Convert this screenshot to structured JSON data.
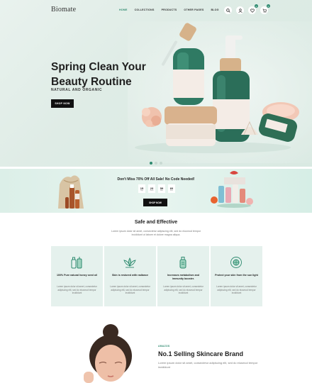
{
  "header": {
    "logo": "Biomate",
    "nav": [
      "HOME",
      "COLLECTIONS",
      "PRODUCTS",
      "OTHER PAGES",
      "BLOG"
    ],
    "icons": [
      "search-icon",
      "user-icon",
      "heart-icon",
      "cart-icon"
    ],
    "wishlist_count": "0",
    "cart_count": "0"
  },
  "hero": {
    "title": "Spring Clean Your Beauty Routine",
    "subtitle": "NATURAL AND ORGANIC",
    "button": "SHOP NOW",
    "product_labels": [
      "SQUALANE OIL",
      "SQUALANE + OMEGA REPAIR CREAM",
      "BIOSSANCE"
    ]
  },
  "promo": {
    "text": "Don't Miss 70% Off All Sale! No Code Needed!",
    "countdown": [
      {
        "value": "15",
        "label": "Days"
      },
      {
        "value": "23",
        "label": "Hours"
      },
      {
        "value": "59",
        "label": "Mins"
      },
      {
        "value": "60",
        "label": "Secs"
      }
    ],
    "button": "SHOP NOW"
  },
  "safe": {
    "title": "Safe and Effective",
    "text": "Lorem ipsum dolor sit amet, consectetur adipiscing elit, sed do eiusmod tempor incididunt ut labore et dolore magna aliqua.",
    "features": [
      {
        "icon": "bottle-icon",
        "title": "100% Pure natural honey seed oil",
        "text": "Lorem ipsum dolor sit amet, consectetur adipiscing elit, sed do eiusmod tempor incididunt"
      },
      {
        "icon": "lotus-icon",
        "title": "Skin is restored with radiance",
        "text": "Lorem ipsum dolor sit amet, consectetur adipiscing elit, sed do eiusmod tempor incididunt"
      },
      {
        "icon": "tube-icon",
        "title": "Increases metabolism and immunity booster.",
        "text": "Lorem ipsum dolor sit amet, consectetur adipiscing elit, sed do eiusmod tempor incididunt"
      },
      {
        "icon": "sun-protect-icon",
        "title": "Protect your skin from the sun light",
        "text": "Lorem ipsum dolor sit amet, consectetur adipiscing elit, sed do eiusmod tempor incididunt"
      }
    ]
  },
  "about": {
    "label": "AMAZOS",
    "title": "No.1 Selling Skincare Brand",
    "text": "Lorem ipsum dolor sit amet, consectetur adipiscing elit, sed do eiusmod tempor incididunt"
  },
  "colors": {
    "accent": "#2e8a6f",
    "hero_bg": "#e2eee9",
    "card_bg": "#e5f1ed"
  }
}
